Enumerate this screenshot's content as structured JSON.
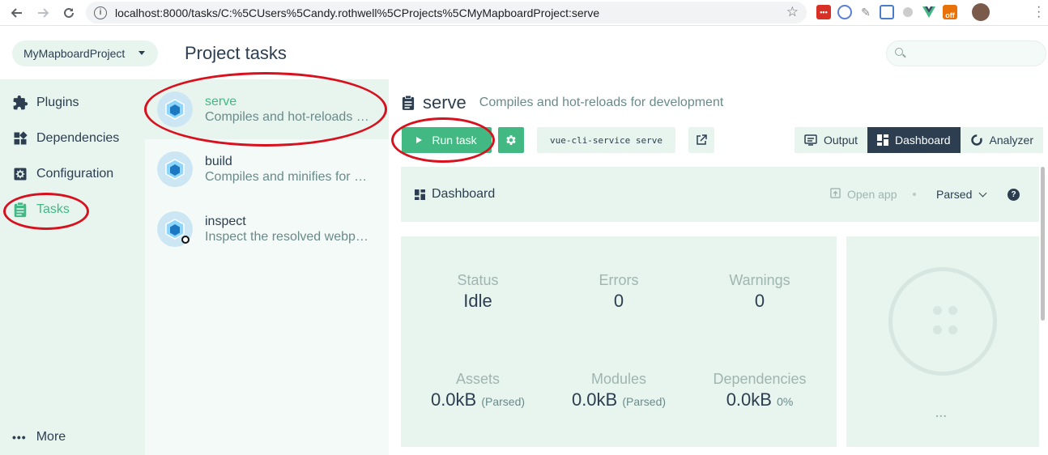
{
  "browser": {
    "url": "localhost:8000/tasks/C:%5CUsers%5Candy.rothwell%5CProjects%5CMyMapboardProject:serve",
    "extensions": [
      {
        "name": "ext-red",
        "label": "•••",
        "color": "#d93025"
      },
      {
        "name": "ext-blue-circle",
        "label": "",
        "color": "#5b7fd6"
      },
      {
        "name": "ext-feather",
        "label": "",
        "color": "#888888"
      },
      {
        "name": "ext-blue-square",
        "label": "",
        "color": "#4a7cc9"
      },
      {
        "name": "ext-gray",
        "label": "",
        "color": "#aaaaaa"
      },
      {
        "name": "ext-vue",
        "label": "",
        "color": "#42b983"
      },
      {
        "name": "ext-off",
        "label": "off",
        "color": "#e8710a"
      }
    ]
  },
  "header": {
    "project_name": "MyMapboardProject",
    "page_title": "Project tasks",
    "search_placeholder": ""
  },
  "sidebar": {
    "items": [
      {
        "label": "Plugins",
        "icon": "puzzle-icon"
      },
      {
        "label": "Dependencies",
        "icon": "widgets-icon"
      },
      {
        "label": "Configuration",
        "icon": "settings-icon"
      },
      {
        "label": "Tasks",
        "icon": "clipboard-icon"
      }
    ],
    "more_label": "More",
    "more_dots": "•••"
  },
  "tasks": [
    {
      "name": "serve",
      "description": "Compiles and hot-reloads for development"
    },
    {
      "name": "build",
      "description": "Compiles and minifies for production"
    },
    {
      "name": "inspect",
      "description": "Inspect the resolved webpack config"
    }
  ],
  "task_detail": {
    "name": "serve",
    "description": "Compiles and hot-reloads for development",
    "run_label": "Run task",
    "command": "vue-cli-service serve"
  },
  "view_tabs": {
    "output": "Output",
    "dashboard": "Dashboard",
    "analyzer": "Analyzer"
  },
  "dashboard": {
    "title": "Dashboard",
    "open_app": "Open app",
    "mode": "Parsed",
    "help": "?",
    "stats": {
      "status_label": "Status",
      "status_value": "Idle",
      "errors_label": "Errors",
      "errors_value": "0",
      "warnings_label": "Warnings",
      "warnings_value": "0",
      "assets_label": "Assets",
      "assets_value": "0.0kB",
      "assets_note": "(Parsed)",
      "modules_label": "Modules",
      "modules_value": "0.0kB",
      "modules_note": "(Parsed)",
      "deps_label": "Dependencies",
      "deps_value": "0.0kB",
      "deps_note": "0%"
    },
    "side_more": "..."
  },
  "colors": {
    "accent": "#42b983",
    "dark": "#2c3e50",
    "panel": "#e8f5ef",
    "annotation": "#d8111f"
  }
}
